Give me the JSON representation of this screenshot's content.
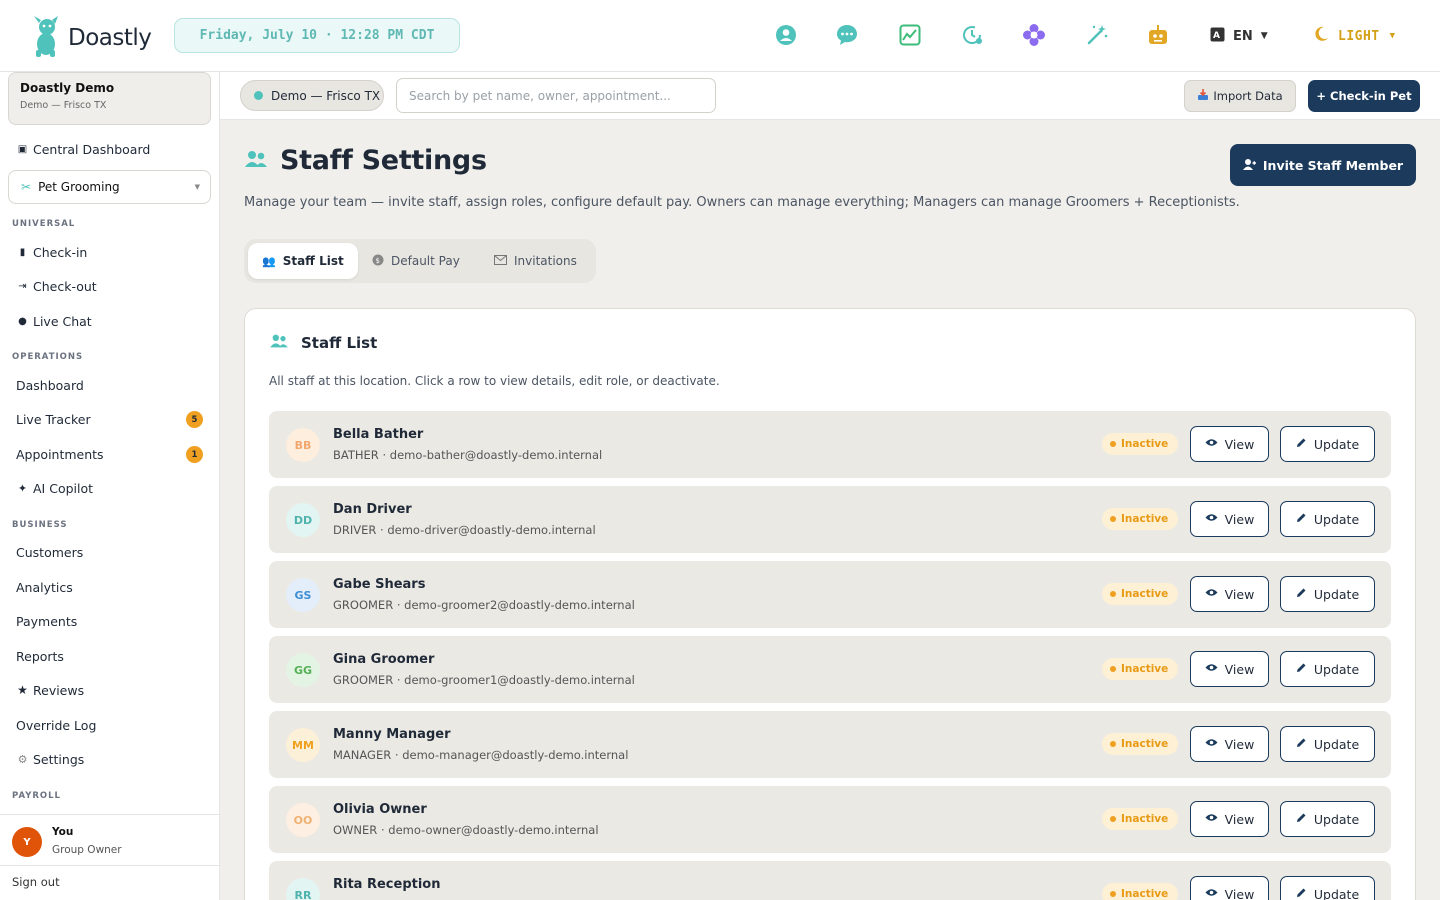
{
  "brand": {
    "name": "Doastly",
    "accent": "#4fc3bb",
    "navy": "#1b3a5c"
  },
  "topbar": {
    "datetime": "Friday, July 10 · 12:28 PM CDT",
    "icons": [
      "user-circle-icon",
      "chat-bubble-icon",
      "chart-image-icon",
      "clock-refresh-icon",
      "flower-icon",
      "magic-wand-icon",
      "robot-icon"
    ],
    "language": "EN",
    "theme": "LIGHT"
  },
  "sidebar": {
    "org_name": "Doastly Demo",
    "org_location": "Demo — Frisco TX",
    "central_dashboard": "Central Dashboard",
    "module": "Pet Grooming",
    "sections": {
      "universal": "UNIVERSAL",
      "operations": "OPERATIONS",
      "business": "BUSINESS",
      "payroll": "PAYROLL"
    },
    "universal_items": [
      "Check-in",
      "Check-out",
      "Live Chat"
    ],
    "operations_items": [
      "Dashboard",
      "Live Tracker",
      "Appointments",
      "AI Copilot"
    ],
    "live_tracker_count": "5",
    "appointments_count": "1",
    "business_items": [
      "Customers",
      "Analytics",
      "Payments",
      "Reports",
      "Reviews",
      "Override Log",
      "Settings"
    ],
    "user": {
      "initial": "Y",
      "name": "You",
      "role": "Group Owner"
    },
    "sign_out": "Sign out"
  },
  "subheader": {
    "location": "Demo — Frisco TX",
    "search_placeholder": "Search by pet name, owner, appointment...",
    "import_label": "Import Data",
    "checkin_label": "+ Check-in Pet"
  },
  "page": {
    "title": "Staff Settings",
    "description": "Manage your team — invite staff, assign roles, configure default pay. Owners can manage everything; Managers can manage Groomers + Receptionists.",
    "invite_label": "Invite Staff Member",
    "tabs": [
      "Staff List",
      "Default Pay",
      "Invitations"
    ]
  },
  "staff_card": {
    "title": "Staff List",
    "description": "All staff at this location. Click a row to view details, edit role, or deactivate.",
    "view_label": "View",
    "update_label": "Update",
    "rows": [
      {
        "initials": "BB",
        "name": "Bella Bather",
        "role": "BATHER",
        "email": "demo-bather@doastly-demo.internal",
        "status": "Inactive",
        "avatar_bg": "#fdeedd",
        "avatar_fg": "#f0a870"
      },
      {
        "initials": "DD",
        "name": "Dan Driver",
        "role": "DRIVER",
        "email": "demo-driver@doastly-demo.internal",
        "status": "Inactive",
        "avatar_bg": "#e2f5f3",
        "avatar_fg": "#4fb3ad"
      },
      {
        "initials": "GS",
        "name": "Gabe Shears",
        "role": "GROOMER",
        "email": "demo-groomer2@doastly-demo.internal",
        "status": "Inactive",
        "avatar_bg": "#e3eefa",
        "avatar_fg": "#3d8fd6"
      },
      {
        "initials": "GG",
        "name": "Gina Groomer",
        "role": "GROOMER",
        "email": "demo-groomer1@doastly-demo.internal",
        "status": "Inactive",
        "avatar_bg": "#e4f4e4",
        "avatar_fg": "#55b055"
      },
      {
        "initials": "MM",
        "name": "Manny Manager",
        "role": "MANAGER",
        "email": "demo-manager@doastly-demo.internal",
        "status": "Inactive",
        "avatar_bg": "#fdf0d8",
        "avatar_fg": "#f0a020"
      },
      {
        "initials": "OO",
        "name": "Olivia Owner",
        "role": "OWNER",
        "email": "demo-owner@doastly-demo.internal",
        "status": "Inactive",
        "avatar_bg": "#fdf0e2",
        "avatar_fg": "#f0b070"
      },
      {
        "initials": "RR",
        "name": "Rita Reception",
        "role": "",
        "email": "",
        "status": "Inactive",
        "avatar_bg": "#e2f5f3",
        "avatar_fg": "#4fb3ad"
      }
    ]
  }
}
